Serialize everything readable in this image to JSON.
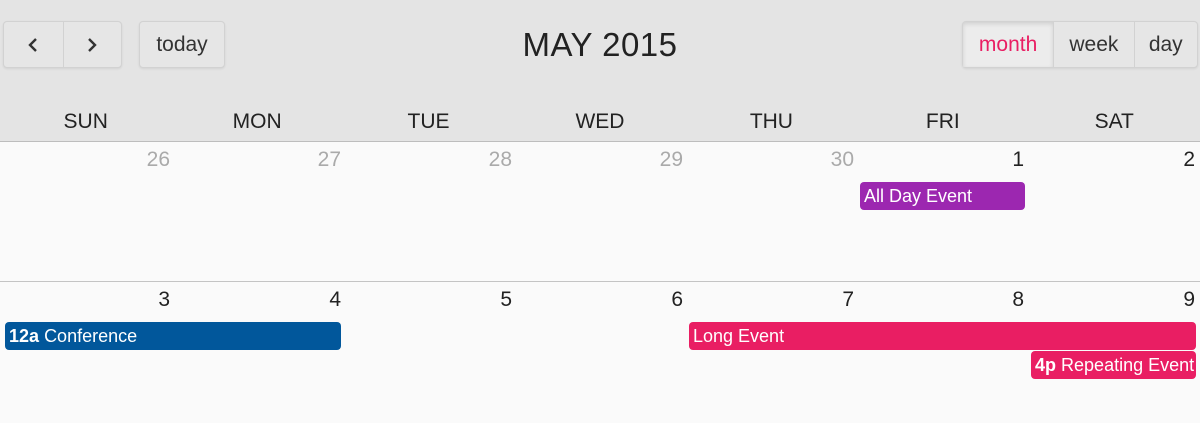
{
  "title": "MAY 2015",
  "nav": {
    "prev_icon": "chevron-left-icon",
    "next_icon": "chevron-right-icon",
    "today_label": "today"
  },
  "views": {
    "month_label": "month",
    "week_label": "week",
    "day_label": "day",
    "active": "month",
    "active_color": "#e91e63"
  },
  "day_headers": [
    "SUN",
    "MON",
    "TUE",
    "WED",
    "THU",
    "FRI",
    "SAT"
  ],
  "weeks": [
    {
      "days": [
        "26",
        "27",
        "28",
        "29",
        "30",
        "1",
        "2"
      ],
      "other_month": [
        true,
        true,
        true,
        true,
        true,
        false,
        false
      ]
    },
    {
      "days": [
        "3",
        "4",
        "5",
        "6",
        "7",
        "8",
        "9"
      ],
      "other_month": [
        false,
        false,
        false,
        false,
        false,
        false,
        false
      ]
    }
  ],
  "events": {
    "all_day": {
      "title": "All Day Event",
      "color": "#9c27b0"
    },
    "conference": {
      "time": "12a",
      "title": "Conference",
      "color": "#01579b"
    },
    "long_event": {
      "title": "Long Event",
      "color": "#e91e63"
    },
    "repeating": {
      "time": "4p",
      "title": "Repeating Event",
      "color": "#e91e63"
    }
  }
}
